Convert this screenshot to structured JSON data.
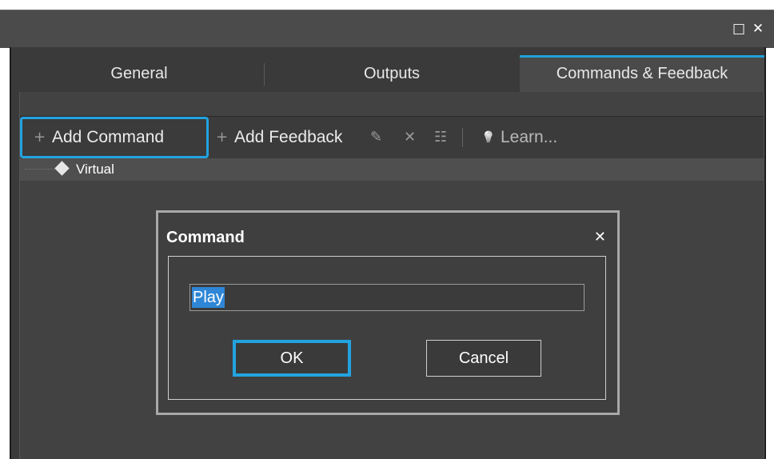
{
  "window": {
    "maximize_glyph": "□",
    "close_glyph": "✕"
  },
  "tabs": [
    {
      "label": "General",
      "active": false
    },
    {
      "label": "Outputs",
      "active": false
    },
    {
      "label": "Commands & Feedback",
      "active": true
    }
  ],
  "toolbar": {
    "add_command": {
      "icon": "plus-icon",
      "glyph": "+",
      "label": "Add Command"
    },
    "add_feedback": {
      "icon": "plus-icon",
      "glyph": "+",
      "label": "Add Feedback"
    },
    "edit": {
      "icon": "pencil-icon",
      "glyph": "✎"
    },
    "delete": {
      "icon": "close-icon",
      "glyph": "✕"
    },
    "properties": {
      "icon": "list-icon",
      "glyph": "☷"
    },
    "learn": {
      "icon": "lightbulb-icon",
      "glyph": "💡",
      "label": "Learn..."
    }
  },
  "tree": {
    "root": {
      "label": "Virtual",
      "icon": "diamond-icon"
    }
  },
  "dialog": {
    "title": "Command",
    "close_glyph": "✕",
    "input_value": "Play",
    "ok_label": "OK",
    "cancel_label": "Cancel"
  },
  "colors": {
    "accent": "#22a3e0",
    "selection": "#2f86d6"
  }
}
